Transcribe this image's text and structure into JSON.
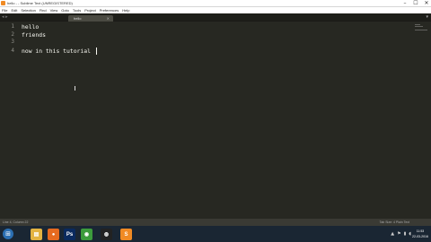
{
  "window": {
    "title": "hello - - Sublime Text (UNREGISTERED)",
    "controls": {
      "minimize": "–",
      "maximize": "☐",
      "close": "✕"
    }
  },
  "menu": [
    "File",
    "Edit",
    "Selection",
    "Find",
    "View",
    "Goto",
    "Tools",
    "Project",
    "Preferences",
    "Help"
  ],
  "tabs": {
    "nav_arrows": "◂ ▸",
    "active_tab": "hello",
    "close_glyph": "×",
    "menu_glyph": "▾"
  },
  "editor": {
    "lines": [
      {
        "number": "1",
        "text": "hello"
      },
      {
        "number": "2",
        "text": "friends"
      },
      {
        "number": "3",
        "text": ""
      },
      {
        "number": "4",
        "text": "now in this tutorial "
      }
    ],
    "colors": {
      "background": "#272822",
      "text": "#f8f8f2",
      "gutter": "#90908a"
    }
  },
  "statusbar": {
    "left": "Line 4, Column 22",
    "right": "Tab Size: 4     Plain Text"
  },
  "taskbar": {
    "start_glyph": "⊞",
    "apps": [
      {
        "name": "explorer-app",
        "glyph": "▤",
        "color": "#e3b341"
      },
      {
        "name": "firefox-app",
        "glyph": "●",
        "color": "#e66a1f"
      },
      {
        "name": "photoshop-app",
        "glyph": "Ps",
        "color": "#0a2a5e"
      },
      {
        "name": "chrome-app",
        "glyph": "◉",
        "color": "#3c9b3c"
      },
      {
        "name": "media-app",
        "glyph": "◍",
        "color": "#222"
      },
      {
        "name": "sublime-app",
        "glyph": "S",
        "color": "#f08a24"
      }
    ],
    "tray": [
      "▲",
      "⚑",
      "▮",
      "◖"
    ],
    "clock_time": "11:53",
    "clock_date": "22-03-2016"
  }
}
